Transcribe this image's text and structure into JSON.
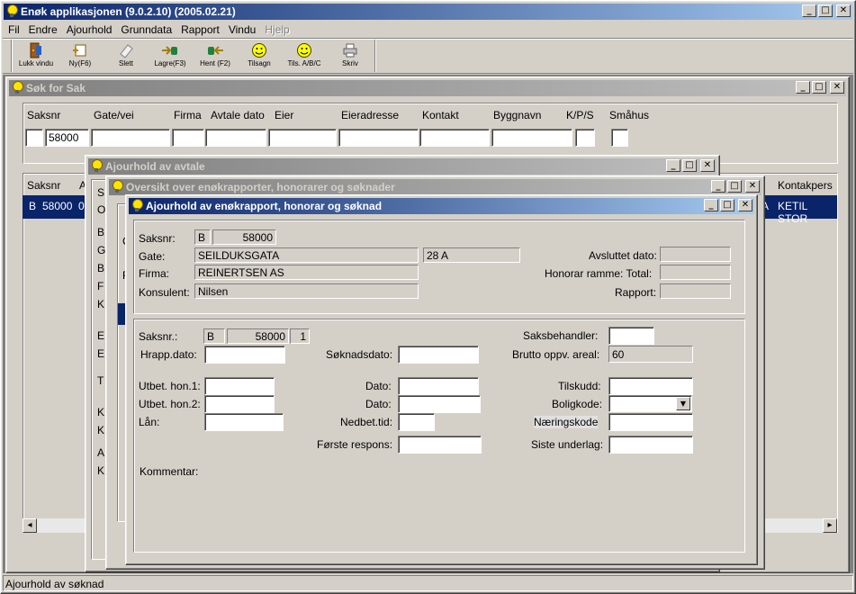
{
  "app": {
    "title": "Enøk applikasjonen  (9.0.2.10) (2005.02.21)"
  },
  "menu": [
    "Fil",
    "Endre",
    "Ajourhold",
    "Grunndata",
    "Rapport",
    "Vindu",
    "Hjelp"
  ],
  "toolbar": [
    {
      "label": "Lukk vindu",
      "icon": "door-exit-icon"
    },
    {
      "label": "Ny(F6)",
      "icon": "new-record-icon"
    },
    {
      "label": "Slett",
      "icon": "eraser-icon"
    },
    {
      "label": "Lagre(F3)",
      "icon": "save-arrow-icon"
    },
    {
      "label": "Hent (F2)",
      "icon": "fetch-arrow-icon"
    },
    {
      "label": "Tilsagn",
      "icon": "smiley-icon"
    },
    {
      "label": "Tils. A/B/C",
      "icon": "smiley-icon"
    },
    {
      "label": "Skriv",
      "icon": "printer-icon"
    }
  ],
  "search": {
    "title": "Søk for Sak",
    "headers": [
      "Saksnr",
      "Gate/vei",
      "Firma",
      "Avtale dato",
      "Eier",
      "Eieradresse",
      "Kontakt",
      "Byggnavn",
      "K/P/S",
      "Småhus"
    ],
    "saksnr_prefix": "",
    "saksnr": "58000",
    "list_headers": [
      "Saksnr",
      "A",
      "Kontakpers"
    ],
    "row": {
      "prefix": "B",
      "saksnr": "58000",
      "tail": "0",
      "a_col": "A",
      "kontakt": "KETIL STOR"
    }
  },
  "avtale": {
    "title": "Ajourhold av avtale",
    "side_letters": [
      "S",
      "O",
      "B",
      "G",
      "B",
      "F",
      "K",
      "E",
      "E",
      "T",
      "K",
      "K",
      "A",
      "K"
    ]
  },
  "oversikt": {
    "title": "Oversikt over enøkrapporter, honorarer og søknader",
    "side_letters": [
      "C",
      "F"
    ]
  },
  "dialog": {
    "title": "Ajourhold av enøkrapport, honorar og søknad",
    "top": {
      "saksnr_label": "Saksnr:",
      "saksnr_prefix": "B",
      "saksnr": "58000",
      "gate_label": "Gate:",
      "gate": "SEILDUKSGATA",
      "husnr": "28 A",
      "firma_label": "Firma:",
      "firma": "REINERTSEN AS",
      "konsulent_label": "Konsulent:",
      "konsulent": "Nilsen",
      "avsluttet_label": "Avsluttet dato:",
      "avsluttet": "",
      "honorar_label": "Honorar ramme: Total:",
      "honorar": "",
      "rapport_label": "Rapport:",
      "rapport": ""
    },
    "form": {
      "saksnr_label": "Saksnr.:",
      "saksnr_prefix": "B",
      "saksnr": "58000",
      "lopenr": "1",
      "hrapp_label": "Hrapp.dato:",
      "hrapp": "",
      "soknadsdato_label": "Søknadsdato:",
      "soknadsdato": "",
      "saksbehandler_label": "Saksbehandler:",
      "saksbehandler": "",
      "brutto_label": "Brutto oppv. areal:",
      "brutto": "60",
      "utbet1_label": "Utbet. hon.1:",
      "utbet1": "",
      "utbet2_label": "Utbet. hon.2:",
      "utbet2": "",
      "lan_label": "Lån:",
      "lan": "",
      "dato1_label": "Dato:",
      "dato1": "",
      "dato2_label": "Dato:",
      "dato2": "",
      "nedbet_label": "Nedbet.tid:",
      "nedbet": "",
      "tilskudd_label": "Tilskudd:",
      "tilskudd": "",
      "boligkode_label": "Boligkode:",
      "boligkode": "",
      "naeringskode_label": "Næringskode",
      "naeringskode": "",
      "forste_label": "Første respons:",
      "forste": "",
      "siste_label": "Siste underlag:",
      "siste": "",
      "kommentar_label": "Kommentar:"
    }
  },
  "status": {
    "text": "Ajourhold av søknad"
  }
}
